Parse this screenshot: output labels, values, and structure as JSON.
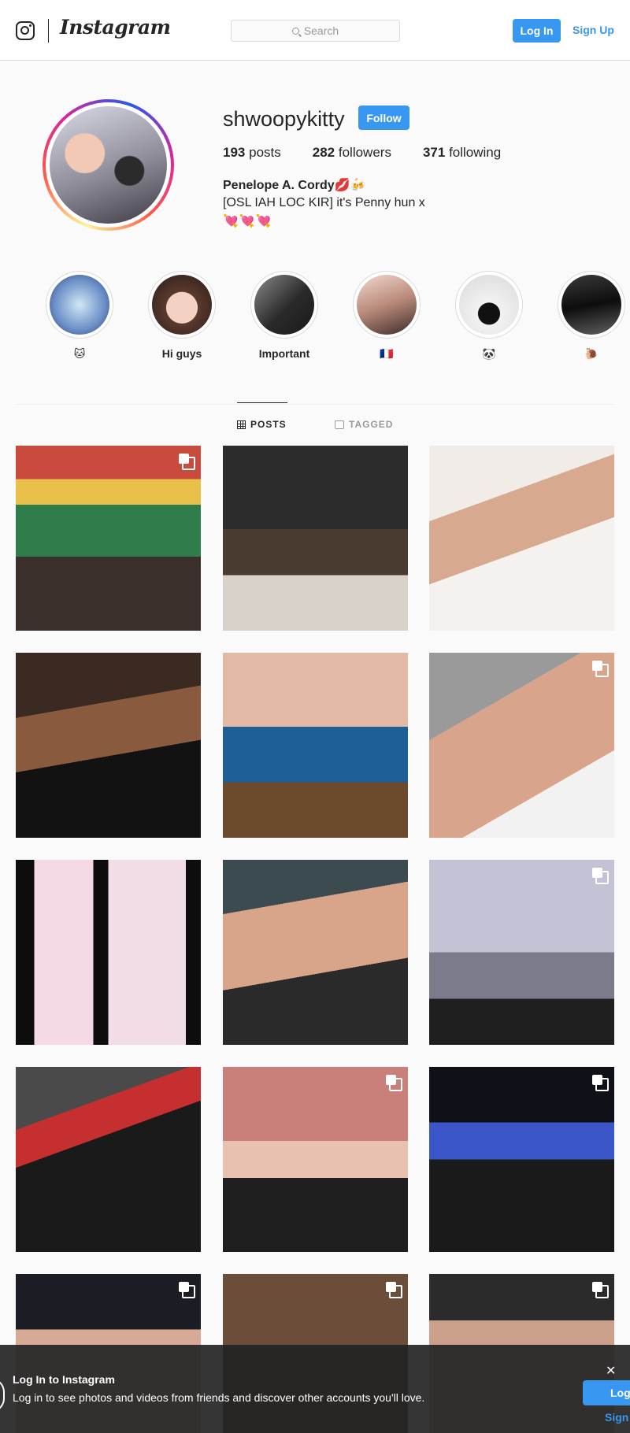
{
  "nav": {
    "brand": "Instagram",
    "search_placeholder": "Search",
    "login_label": "Log In",
    "signup_label": "Sign Up",
    "icons": [
      "instagram-glyph-icon",
      "search-icon"
    ]
  },
  "profile": {
    "username": "shwoopykitty",
    "follow_label": "Follow",
    "posts_count": "193",
    "posts_label": "posts",
    "followers_count": "282",
    "followers_label": "followers",
    "following_count": "371",
    "following_label": "following",
    "full_name": "Penelope A. Cordy💋🍻",
    "bio_line": "[OSL IAH LOC KIR] it's Penny hun x",
    "bio_emoji": "💘💘💘"
  },
  "highlights": [
    {
      "label": "🐱"
    },
    {
      "label": "Hi guys"
    },
    {
      "label": "Important"
    },
    {
      "label": "🇫🇷"
    },
    {
      "label": "🐼"
    },
    {
      "label": "🐌"
    }
  ],
  "tabs": {
    "posts": "POSTS",
    "tagged": "TAGGED"
  },
  "posts": [
    {
      "multiple": true
    },
    {
      "multiple": false
    },
    {
      "multiple": false
    },
    {
      "multiple": false
    },
    {
      "multiple": false
    },
    {
      "multiple": true
    },
    {
      "multiple": false
    },
    {
      "multiple": false
    },
    {
      "multiple": true
    },
    {
      "multiple": false
    },
    {
      "multiple": true
    },
    {
      "multiple": true
    },
    {
      "multiple": true
    },
    {
      "multiple": true
    },
    {
      "multiple": true
    }
  ],
  "login_bar": {
    "title": "Log In to Instagram",
    "subtitle": "Log in to see photos and videos from friends and discover other accounts you'll love.",
    "close": "✕",
    "login_label": "Log",
    "signup_label": "Sign"
  },
  "colors": {
    "accent": "#3897f0",
    "text": "#262626",
    "muted": "#999999",
    "border": "#dbdbdb",
    "background": "#fafafa"
  }
}
